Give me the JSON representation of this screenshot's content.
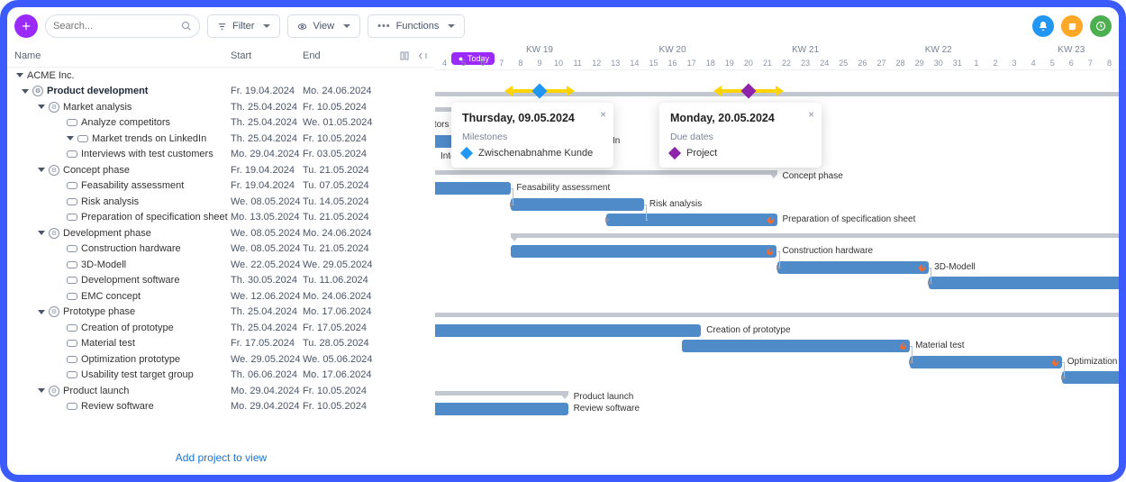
{
  "toolbar": {
    "search_placeholder": "Search...",
    "filter_label": "Filter",
    "view_label": "View",
    "functions_label": "Functions"
  },
  "columns": {
    "name": "Name",
    "start": "Start",
    "end": "End"
  },
  "add_project_link": "Add project to view",
  "company": "ACME Inc.",
  "timeline": {
    "today_label": "Today",
    "weeks": [
      "KW 19",
      "KW 20",
      "KW 21",
      "KW 22",
      "KW 23"
    ],
    "days": [
      4,
      5,
      6,
      7,
      8,
      9,
      10,
      11,
      12,
      13,
      14,
      15,
      16,
      17,
      18,
      19,
      20,
      21,
      22,
      23,
      24,
      25,
      26,
      27,
      28,
      29,
      30,
      31,
      1,
      2,
      3,
      4,
      5,
      6,
      7,
      8
    ]
  },
  "popover1": {
    "title": "Thursday, 09.05.2024",
    "subtitle": "Milestones",
    "item": "Zwischenabnahme Kunde"
  },
  "popover2": {
    "title": "Monday, 20.05.2024",
    "subtitle": "Due dates",
    "item": "Project"
  },
  "rows": [
    {
      "type": "project",
      "level": 1,
      "name": "Product development",
      "start": "Fr. 19.04.2024",
      "end": "Mo. 24.06.2024"
    },
    {
      "type": "group",
      "level": 2,
      "name": "Market analysis",
      "start": "Th. 25.04.2024",
      "end": "Fr. 10.05.2024"
    },
    {
      "type": "task",
      "level": 3,
      "name": "Analyze competitors",
      "start": "Th. 25.04.2024",
      "end": "We. 01.05.2024",
      "bar_label": "competitors"
    },
    {
      "type": "task",
      "level": 3,
      "name": "Market trends on LinkedIn",
      "start": "Th. 25.04.2024",
      "end": "Fr. 10.05.2024",
      "bar_label": "on LinkedIn",
      "tri": true
    },
    {
      "type": "task",
      "level": 3,
      "name": "Interviews with test customers",
      "start": "Mo. 29.04.2024",
      "end": "Fr. 03.05.2024",
      "bar_label": "Intervie"
    },
    {
      "type": "group",
      "level": 2,
      "name": "Concept phase",
      "start": "Fr. 19.04.2024",
      "end": "Tu. 21.05.2024",
      "bar_label": "Concept phase"
    },
    {
      "type": "task",
      "level": 3,
      "name": "Feasability assessment",
      "start": "Fr. 19.04.2024",
      "end": "Tu. 07.05.2024",
      "bar_label": "Feasability assessment"
    },
    {
      "type": "task",
      "level": 3,
      "name": "Risk analysis",
      "start": "We. 08.05.2024",
      "end": "Tu. 14.05.2024",
      "bar_label": "Risk analysis"
    },
    {
      "type": "task",
      "level": 3,
      "name": "Preparation of specification sheet",
      "start": "Mo. 13.05.2024",
      "end": "Tu. 21.05.2024",
      "bar_label": "Preparation of specification sheet",
      "fire": true
    },
    {
      "type": "group",
      "level": 2,
      "name": "Development phase",
      "start": "We. 08.05.2024",
      "end": "Mo. 24.06.2024"
    },
    {
      "type": "task",
      "level": 3,
      "name": "Construction hardware",
      "start": "We. 08.05.2024",
      "end": "Tu. 21.05.2024",
      "bar_label": "Construction hardware",
      "fire": true
    },
    {
      "type": "task",
      "level": 3,
      "name": "3D-Modell",
      "start": "We. 22.05.2024",
      "end": "We. 29.05.2024",
      "bar_label": "3D-Modell",
      "fire": true
    },
    {
      "type": "task",
      "level": 3,
      "name": "Development software",
      "start": "Th. 30.05.2024",
      "end": "Tu. 11.06.2024"
    },
    {
      "type": "task",
      "level": 3,
      "name": "EMC concept",
      "start": "We. 12.06.2024",
      "end": "Mo. 24.06.2024"
    },
    {
      "type": "group",
      "level": 2,
      "name": "Prototype phase",
      "start": "Th. 25.04.2024",
      "end": "Mo. 17.06.2024"
    },
    {
      "type": "task",
      "level": 3,
      "name": "Creation of prototype",
      "start": "Th. 25.04.2024",
      "end": "Fr. 17.05.2024",
      "bar_label": "Creation of prototype"
    },
    {
      "type": "task",
      "level": 3,
      "name": "Material test",
      "start": "Fr. 17.05.2024",
      "end": "Tu. 28.05.2024",
      "bar_label": "Material test",
      "fire": true
    },
    {
      "type": "task",
      "level": 3,
      "name": "Optimization prototype",
      "start": "We. 29.05.2024",
      "end": "We. 05.06.2024",
      "bar_label": "Optimization pr",
      "fire": true
    },
    {
      "type": "task",
      "level": 3,
      "name": "Usability test target group",
      "start": "Th. 06.06.2024",
      "end": "Mo. 17.06.2024"
    },
    {
      "type": "group",
      "level": 2,
      "name": "Product launch",
      "start": "Mo. 29.04.2024",
      "end": "Fr. 10.05.2024",
      "bar_label": "Product launch"
    },
    {
      "type": "task",
      "level": 3,
      "name": "Review software",
      "start": "Mo. 29.04.2024",
      "end": "Fr. 10.05.2024",
      "bar_label": "Review software"
    }
  ],
  "chart_data": {
    "type": "gantt",
    "x_unit": "day",
    "x_start": "2024-05-04",
    "x_end": "2024-06-08",
    "milestones": [
      {
        "date": "2024-05-09",
        "name": "Zwischenabnahme Kunde",
        "color": "#2196f3"
      },
      {
        "date": "2024-05-20",
        "name": "Project",
        "color": "#8e24aa",
        "kind": "due"
      }
    ],
    "bars": [
      {
        "row": 0,
        "kind": "group",
        "start": "2024-04-19",
        "end": "2024-06-24"
      },
      {
        "row": 1,
        "kind": "group",
        "start": "2024-04-25",
        "end": "2024-05-10"
      },
      {
        "row": 2,
        "kind": "task",
        "start": "2024-04-25",
        "end": "2024-05-01"
      },
      {
        "row": 3,
        "kind": "task",
        "start": "2024-04-25",
        "end": "2024-05-10"
      },
      {
        "row": 4,
        "kind": "task",
        "start": "2024-04-29",
        "end": "2024-05-03"
      },
      {
        "row": 5,
        "kind": "group",
        "start": "2024-04-19",
        "end": "2024-05-21"
      },
      {
        "row": 6,
        "kind": "task",
        "start": "2024-04-19",
        "end": "2024-05-07"
      },
      {
        "row": 7,
        "kind": "task",
        "start": "2024-05-08",
        "end": "2024-05-14"
      },
      {
        "row": 8,
        "kind": "task",
        "start": "2024-05-13",
        "end": "2024-05-21"
      },
      {
        "row": 9,
        "kind": "group",
        "start": "2024-05-08",
        "end": "2024-06-24"
      },
      {
        "row": 10,
        "kind": "task",
        "start": "2024-05-08",
        "end": "2024-05-21"
      },
      {
        "row": 11,
        "kind": "task",
        "start": "2024-05-22",
        "end": "2024-05-29"
      },
      {
        "row": 12,
        "kind": "task",
        "start": "2024-05-30",
        "end": "2024-06-11"
      },
      {
        "row": 13,
        "kind": "task",
        "start": "2024-06-12",
        "end": "2024-06-24"
      },
      {
        "row": 14,
        "kind": "group",
        "start": "2024-04-25",
        "end": "2024-06-17"
      },
      {
        "row": 15,
        "kind": "task",
        "start": "2024-04-25",
        "end": "2024-05-17"
      },
      {
        "row": 16,
        "kind": "task",
        "start": "2024-05-17",
        "end": "2024-05-28"
      },
      {
        "row": 17,
        "kind": "task",
        "start": "2024-05-29",
        "end": "2024-06-05"
      },
      {
        "row": 18,
        "kind": "task",
        "start": "2024-06-06",
        "end": "2024-06-17"
      },
      {
        "row": 19,
        "kind": "group",
        "start": "2024-04-29",
        "end": "2024-05-10"
      },
      {
        "row": 20,
        "kind": "task",
        "start": "2024-04-29",
        "end": "2024-05-10"
      }
    ],
    "links": [
      {
        "from": 6,
        "to": 7
      },
      {
        "from": 7,
        "to": 8
      },
      {
        "from": 10,
        "to": 11
      },
      {
        "from": 11,
        "to": 12
      },
      {
        "from": 16,
        "to": 17
      },
      {
        "from": 17,
        "to": 18
      }
    ]
  }
}
